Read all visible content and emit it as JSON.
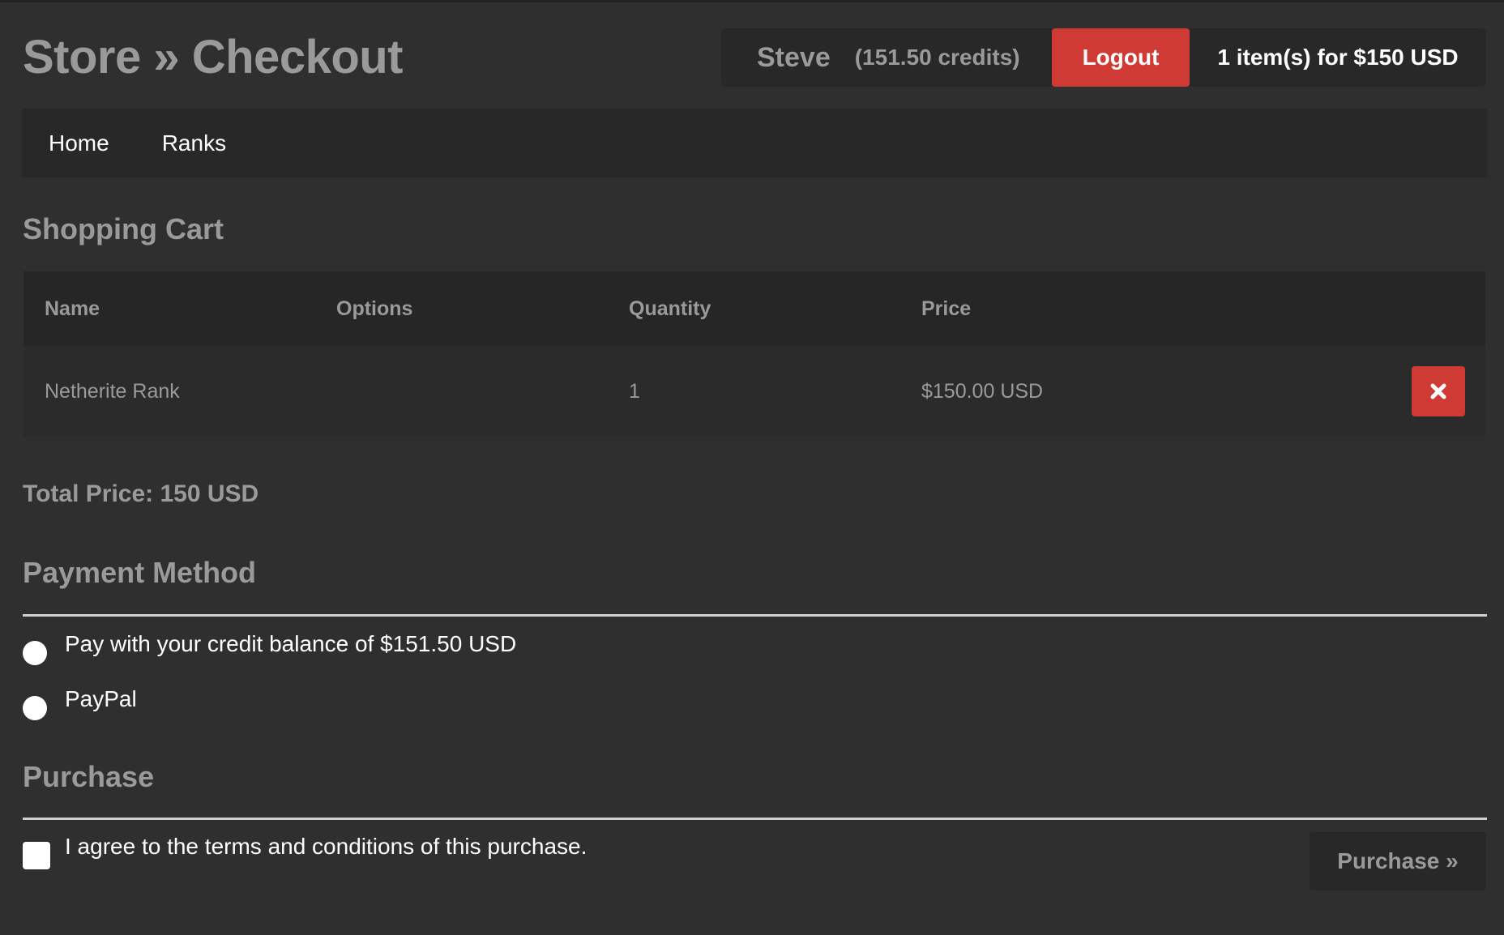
{
  "header": {
    "title": "Store » Checkout",
    "username": "Steve",
    "credits": "(151.50 credits)",
    "logout_label": "Logout",
    "cart_summary": "1 item(s) for $150 USD"
  },
  "nav": {
    "items": [
      {
        "label": "Home"
      },
      {
        "label": "Ranks"
      }
    ]
  },
  "cart": {
    "heading": "Shopping Cart",
    "columns": [
      "Name",
      "Options",
      "Quantity",
      "Price"
    ],
    "rows": [
      {
        "name": "Netherite Rank",
        "options": "",
        "quantity": "1",
        "price": "$150.00 USD",
        "remove_icon": "close-icon"
      }
    ],
    "total": "Total Price: 150 USD"
  },
  "payment": {
    "heading": "Payment Method",
    "options": [
      {
        "label": "Pay with your credit balance of $151.50 USD",
        "selected": false
      },
      {
        "label": "PayPal",
        "selected": false
      }
    ]
  },
  "purchase": {
    "heading": "Purchase",
    "terms_label": "I agree to the terms and conditions of this purchase.",
    "terms_checked": false,
    "button_label": "Purchase »"
  },
  "colors": {
    "background": "#2f2f2f",
    "panel": "#282828",
    "accent_red": "#cf3a35",
    "muted_text": "#9a9a9a",
    "text": "#ffffff"
  }
}
